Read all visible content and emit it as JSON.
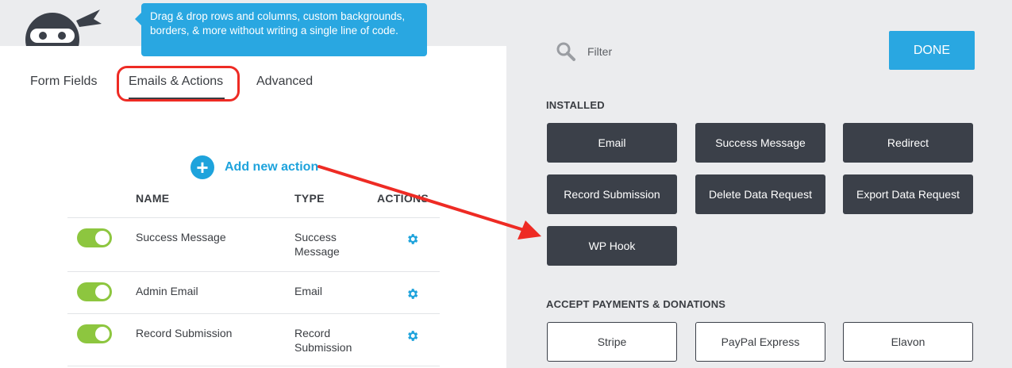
{
  "tooltip": {
    "text": "Drag & drop rows and columns, custom backgrounds, borders, & more without writing a single line of code."
  },
  "tabs": [
    {
      "label": "Form Fields"
    },
    {
      "label": "Emails & Actions",
      "active": true
    },
    {
      "label": "Advanced"
    }
  ],
  "add_action": {
    "label": "Add new action"
  },
  "table": {
    "headers": {
      "name": "NAME",
      "type": "TYPE",
      "actions": "ACTIONS"
    },
    "rows": [
      {
        "enabled": true,
        "name": "Success Message",
        "type": "Success Message"
      },
      {
        "enabled": true,
        "name": "Admin Email",
        "type": "Email"
      },
      {
        "enabled": true,
        "name": "Record Submission",
        "type": "Record Submission"
      }
    ]
  },
  "filter": {
    "placeholder": "Filter"
  },
  "done_button": {
    "label": "DONE"
  },
  "installed": {
    "title": "INSTALLED",
    "items": [
      "Email",
      "Success Message",
      "Redirect",
      "Record Submission",
      "Delete Data Request",
      "Export Data Request",
      "WP Hook"
    ]
  },
  "payments": {
    "title": "ACCEPT PAYMENTS & DONATIONS",
    "items": [
      "Stripe",
      "PayPal Express",
      "Elavon"
    ]
  },
  "colors": {
    "accent_blue": "#29a7e1",
    "toggle_green": "#8dc63f",
    "dark_button": "#3b4049",
    "annotation_red": "#ee2b24",
    "panel_gray": "#ebecee"
  },
  "icons": [
    "ninja-logo-icon",
    "plus-icon",
    "gear-icon",
    "search-icon",
    "arrow-annotation"
  ]
}
